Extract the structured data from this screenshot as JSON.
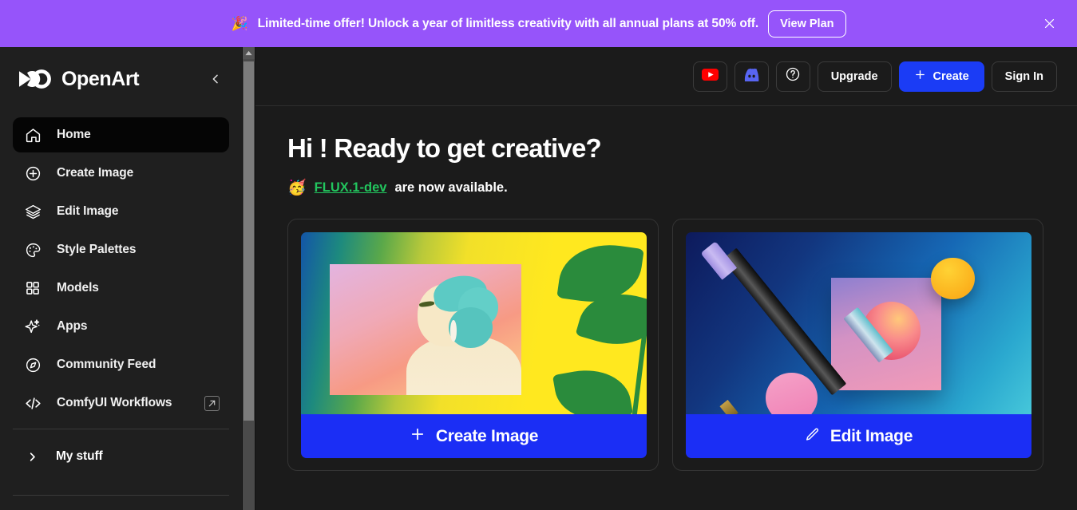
{
  "promo": {
    "emoji": "🎉",
    "text": "Limited-time offer! Unlock a year of limitless creativity with all annual plans at 50% off.",
    "button_label": "View Plan",
    "close_icon": "close-icon",
    "background_color": "#9654fa"
  },
  "sidebar": {
    "brand_name": "OpenArt",
    "logo_icon": "openart-logo-icon",
    "collapse_icon": "chevron-left-icon",
    "items": [
      {
        "label": "Home",
        "icon": "home-icon",
        "active": true
      },
      {
        "label": "Create Image",
        "icon": "plus-circle-icon",
        "active": false
      },
      {
        "label": "Edit Image",
        "icon": "layers-icon",
        "active": false
      },
      {
        "label": "Style Palettes",
        "icon": "palette-icon",
        "active": false
      },
      {
        "label": "Models",
        "icon": "grid-icon",
        "active": false
      },
      {
        "label": "Apps",
        "icon": "sparkle-icon",
        "active": false
      },
      {
        "label": "Community Feed",
        "icon": "compass-icon",
        "active": false
      },
      {
        "label": "ComfyUI Workflows",
        "icon": "code-icon",
        "active": false,
        "external_icon": "external-link-icon"
      }
    ],
    "my_stuff": {
      "label": "My stuff",
      "chevron_icon": "chevron-right-icon"
    },
    "scrollbar": {
      "up_arrow_icon": "scroll-up-arrow-icon",
      "thumb": "scrollbar-thumb"
    }
  },
  "topbar": {
    "youtube_icon": "youtube-icon",
    "discord_icon": "discord-icon",
    "help_icon": "help-circle-icon",
    "upgrade_label": "Upgrade",
    "create_label": "Create",
    "create_icon": "plus-icon",
    "signin_label": "Sign In",
    "primary_color": "#1b3cf5"
  },
  "main": {
    "title": "Hi ! Ready to get creative?",
    "announcement": {
      "emoji": "🥳",
      "link_label": "FLUX.1-dev",
      "link_color": "#22c55e",
      "trailing_text": "are now available."
    },
    "cards": [
      {
        "cta_label": "Create Image",
        "cta_icon": "plus-icon",
        "artwork": "portrait-woman-teal-hair-leaves"
      },
      {
        "cta_label": "Edit Image",
        "cta_icon": "pencil-icon",
        "artwork": "pen-shapes-blue-gradient"
      }
    ]
  }
}
